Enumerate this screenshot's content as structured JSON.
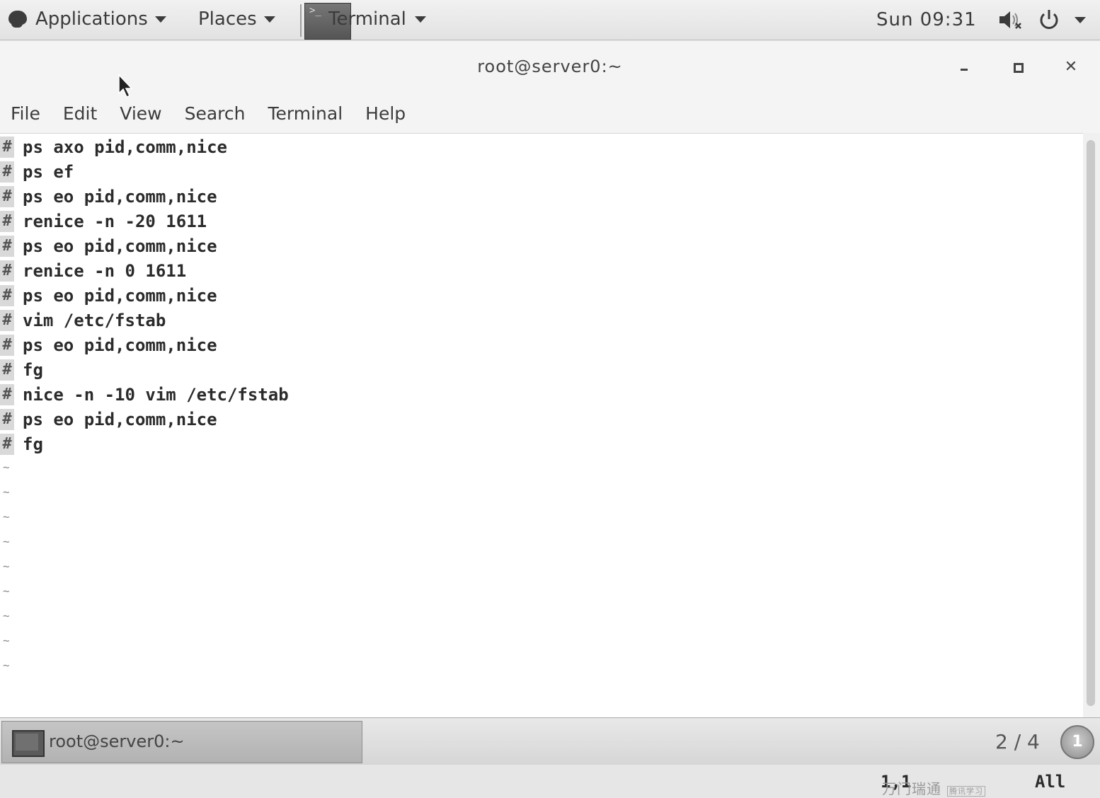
{
  "top_panel": {
    "applications_label": "Applications",
    "places_label": "Places",
    "terminal_label": "Terminal",
    "clock": "Sun 09:31"
  },
  "window": {
    "title": "root@server0:~",
    "menu": [
      "File",
      "Edit",
      "View",
      "Search",
      "Terminal",
      "Help"
    ]
  },
  "terminal": {
    "lines": [
      "ps axo pid,comm,nice",
      "ps ef",
      "ps eo pid,comm,nice",
      "renice -n -20 1611",
      "ps eo pid,comm,nice",
      "renice -n 0 1611",
      "ps eo pid,comm,nice",
      "vim /etc/fstab",
      "ps eo pid,comm,nice",
      "fg",
      "nice -n -10 vim /etc/fstab",
      "ps eo pid,comm,nice",
      "fg"
    ],
    "line_marker": "#",
    "empty_marker": "~",
    "cursor_position": "1,1",
    "scroll_position": "All",
    "watermark": "万门瑞通",
    "watermark_small": "腾讯学习"
  },
  "bottom_panel": {
    "task_label": "root@server0:~",
    "workspace": "2 / 4",
    "notification_count": "1"
  }
}
